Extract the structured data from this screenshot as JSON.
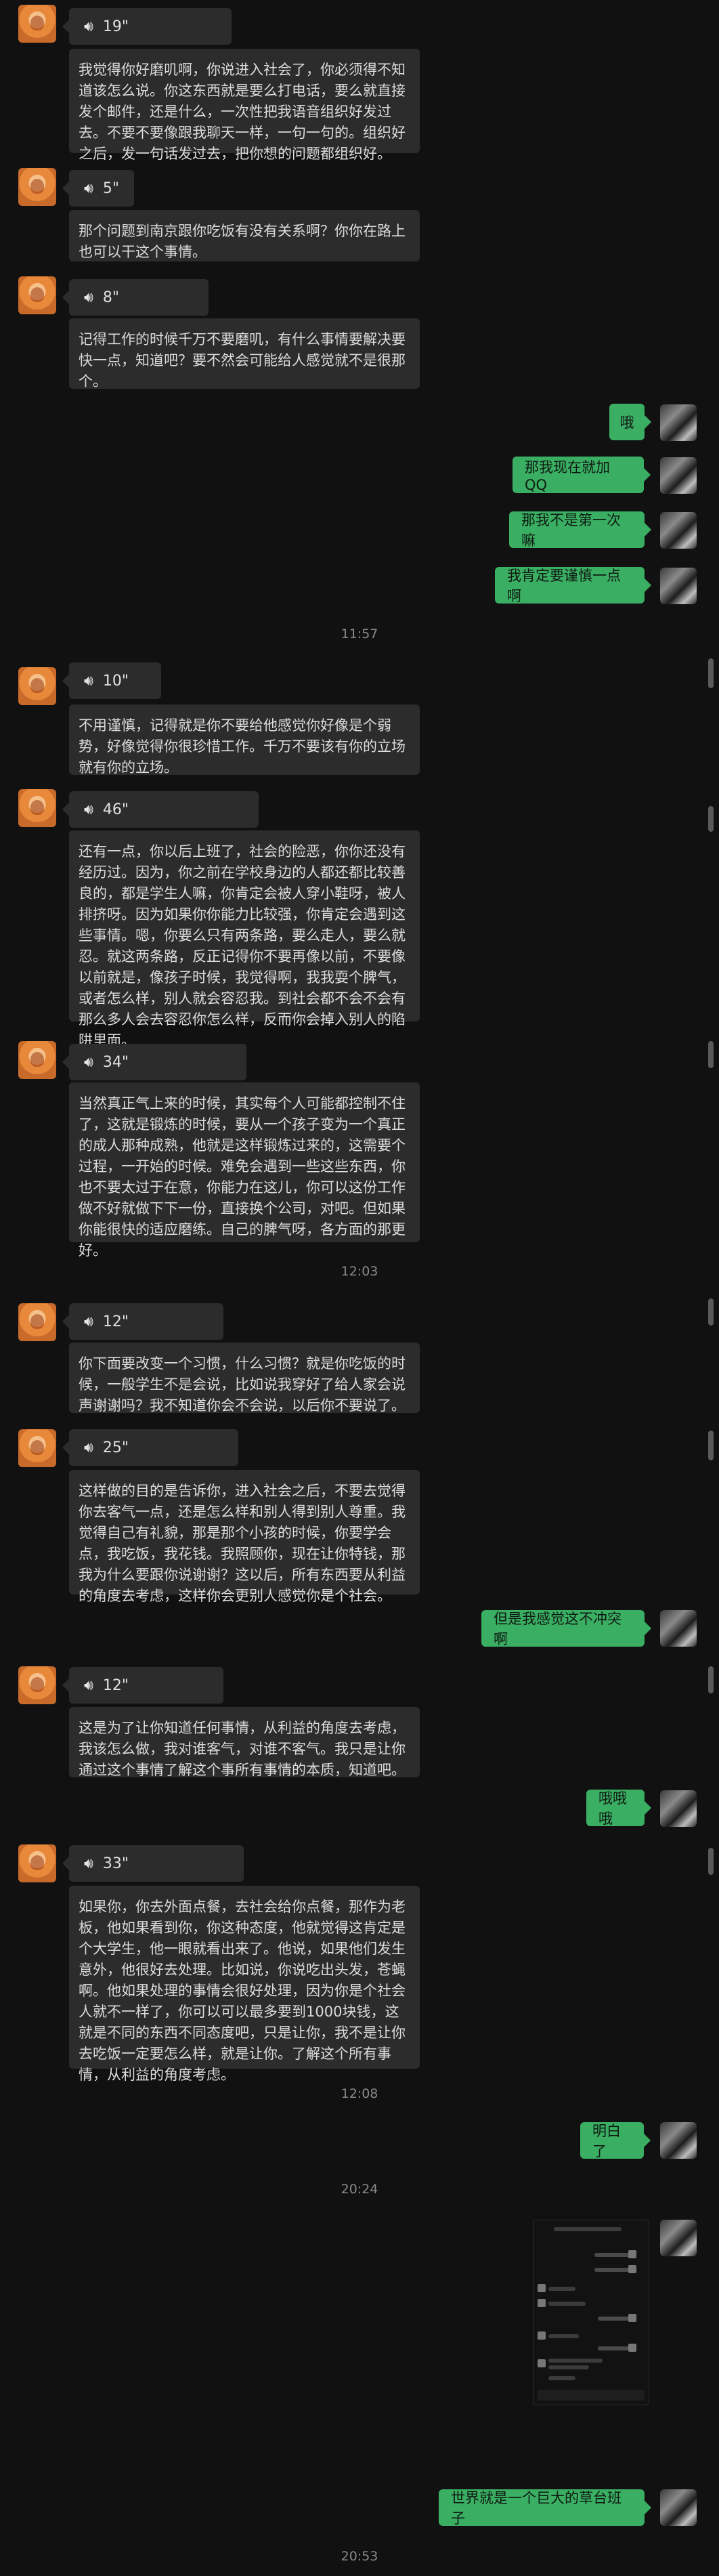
{
  "conversation": {
    "messages": [
      {
        "side": "left",
        "type": "voice",
        "duration": "19\"",
        "transcript": "我觉得你好磨叽啊，你说进入社会了，你必须得不知道该怎么说。你这东西就是要么打电话，要么就直接发个邮件，还是什么，一次性把我语音组织好发过去。不要不要像跟我聊天一样，一句一句的。组织好之后，发一句话发过去，把你想的问题都组织好。"
      },
      {
        "side": "left",
        "type": "voice",
        "duration": "5\"",
        "transcript": "那个问题到南京跟你吃饭有没有关系啊？你你在路上也可以干这个事情。"
      },
      {
        "side": "left",
        "type": "voice",
        "duration": "8\"",
        "transcript": "记得工作的时候千万不要磨叽，有什么事情要解决要快一点，知道吧？要不然会可能给人感觉就不是很那个。"
      },
      {
        "side": "right",
        "type": "text",
        "text": "哦"
      },
      {
        "side": "right",
        "type": "text",
        "text": "那我现在就加QQ"
      },
      {
        "side": "right",
        "type": "text",
        "text": "那我不是第一次嘛"
      },
      {
        "side": "right",
        "type": "text",
        "text": "我肯定要谨慎一点啊"
      },
      {
        "type": "time",
        "text": "11:57"
      },
      {
        "side": "left",
        "type": "voice",
        "duration": "10\"",
        "transcript": "不用谨慎，记得就是你不要给他感觉你好像是个弱势，好像觉得你很珍惜工作。千万不要该有你的立场就有你的立场。"
      },
      {
        "side": "left",
        "type": "voice",
        "duration": "46\"",
        "transcript": "还有一点，你以后上班了，社会的险恶，你你还没有经历过。因为，你之前在学校身边的人都还都比较善良的，都是学生人嘛，你肯定会被人穿小鞋呀，被人排挤呀。因为如果你你能力比较强，你肯定会遇到这些事情。嗯，你要么只有两条路，要么走人，要么就忍。就这两条路，反正记得你不要再像以前，不要像以前就是，像孩子时候，我觉得啊，我我耍个脾气，或者怎么样，别人就会容忍我。到社会都不会不会有那么多人会去容忍你怎么样，反而你会掉入别人的陷阱里面。"
      },
      {
        "side": "left",
        "type": "voice",
        "duration": "34\"",
        "transcript": "当然真正气上来的时候，其实每个人可能都控制不住了，这就是锻炼的时候，要从一个孩子变为一个真正的成人那种成熟，他就是这样锻炼过来的，这需要个过程，一开始的时候。难免会遇到一些这些东西，你也不要太过于在意，你能力在这儿，你可以这份工作做不好就做下下一份，直接换个公司，对吧。但如果你能很快的适应磨练。自己的脾气呀，各方面的那更好。"
      },
      {
        "type": "time",
        "text": "12:03"
      },
      {
        "side": "left",
        "type": "voice",
        "duration": "12\"",
        "transcript": "你下面要改变一个习惯，什么习惯？就是你吃饭的时候，一般学生不是会说，比如说我穿好了给人家会说声谢谢吗？我不知道你会不会说，以后你不要说了。"
      },
      {
        "side": "left",
        "type": "voice",
        "duration": "25\"",
        "transcript": "这样做的目的是告诉你，进入社会之后，不要去觉得你去客气一点，还是怎么样和别人得到别人尊重。我觉得自己有礼貌，那是那个小孩的时候，你要学会点，我吃饭，我花钱。我照顾你，现在让你特钱，那我为什么要跟你说谢谢？这以后，所有东西要从利益的角度去考虑，这样你会更别人感觉你是个社会。"
      },
      {
        "side": "right",
        "type": "text",
        "text": "但是我感觉这不冲突啊"
      },
      {
        "side": "left",
        "type": "voice",
        "duration": "12\"",
        "transcript": "这是为了让你知道任何事情，从利益的角度去考虑，我该怎么做，我对谁客气，对谁不客气。我只是让你通过这个事情了解这个事所有事情的本质，知道吧。"
      },
      {
        "side": "right",
        "type": "text",
        "text": "哦哦哦"
      },
      {
        "side": "left",
        "type": "voice",
        "duration": "33\"",
        "transcript": "如果你，你去外面点餐，去社会给你点餐，那作为老板，他如果看到你，你这种态度，他就觉得这肯定是个大学生，他一眼就看出来了。他说，如果他们发生意外，他很好去处理。比如说，你说吃出头发，苍蝇啊。他如果处理的事情会很好处理，因为你是个社会人就不一样了，你可以可以最多要到1000块钱，这就是不同的东西不同态度吧，只是让你，我不是让你去吃饭一定要怎么样，就是让你。了解这个所有事情，从利益的角度考虑。"
      },
      {
        "type": "time",
        "text": "12:08"
      },
      {
        "side": "right",
        "type": "text",
        "text": "明白了"
      },
      {
        "type": "time",
        "text": "20:24"
      },
      {
        "side": "right",
        "type": "image",
        "alt": "chat screenshot"
      },
      {
        "side": "right",
        "type": "text",
        "text": "世界就是一个巨大的草台班子"
      },
      {
        "type": "time",
        "text": "20:53"
      }
    ]
  }
}
